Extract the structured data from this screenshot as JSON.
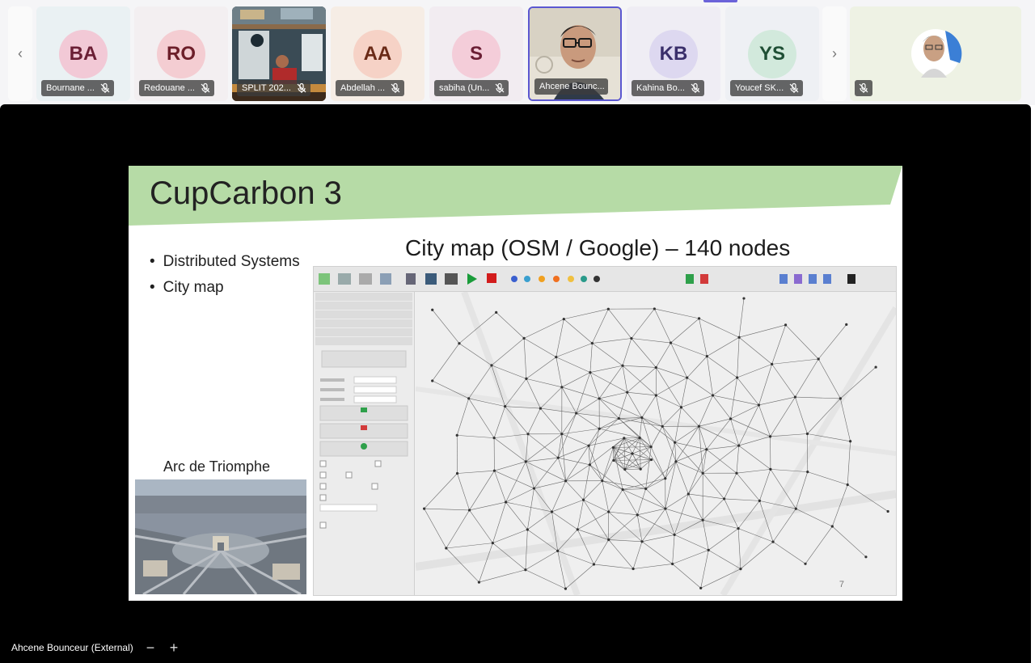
{
  "participants": [
    {
      "initials": "BA",
      "name": "Bournane ...",
      "avatar_bg": "#f2c9d6",
      "text_color": "#6b1f35",
      "tile_bg": "#eaf1f3"
    },
    {
      "initials": "RO",
      "name": "Redouane ...",
      "avatar_bg": "#f4cdd2",
      "text_color": "#6d1f2a",
      "tile_bg": "#f3eff1"
    },
    {
      "video": true,
      "name": "SPLIT 202..."
    },
    {
      "initials": "AA",
      "name": "Abdellah ...",
      "avatar_bg": "#f6d2c6",
      "text_color": "#6a2a17",
      "tile_bg": "#f6ede5"
    },
    {
      "initials": "S",
      "name": "sabiha (Un...",
      "avatar_bg": "#f4cdd9",
      "text_color": "#6b1f35",
      "tile_bg": "#f2ecf1"
    },
    {
      "video": true,
      "active": true,
      "name": "Ahcene Bounc..."
    },
    {
      "initials": "KB",
      "name": "Kahina Bo...",
      "avatar_bg": "#ddd8f0",
      "text_color": "#3a2f6b",
      "tile_bg": "#efedf4"
    },
    {
      "initials": "YS",
      "name": "Youcef SK...",
      "avatar_bg": "#d2e9dc",
      "text_color": "#1f4f35",
      "tile_bg": "#eef0f4"
    },
    {
      "video": true,
      "name": ""
    }
  ],
  "nav": {
    "prev": "‹",
    "next": "›"
  },
  "slide": {
    "title": "CupCarbon 3",
    "bullets": [
      "Distributed Systems",
      "City map"
    ],
    "subtitle": "City map (OSM / Google) – 140 nodes",
    "arc_caption": "Arc de Triomphe",
    "page_number": "7",
    "band_color": "#b6dba6"
  },
  "footer": {
    "presenter": "Ahcene Bounceur (External)",
    "zoom_out": "−",
    "zoom_in": "+"
  }
}
